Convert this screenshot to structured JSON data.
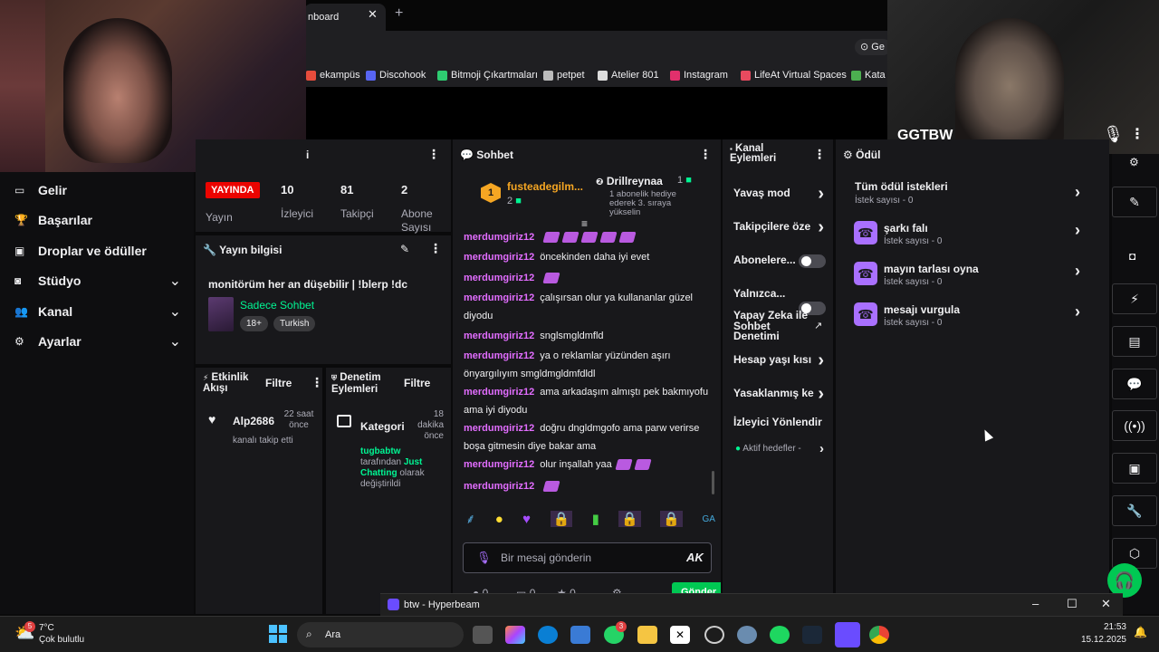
{
  "browser": {
    "tab_title": "nboard",
    "bookmarks": [
      "ekampüs",
      "Discohook",
      "Bitmoji Çıkartmaları",
      "petpet",
      "Atelier 801",
      "Instagram",
      "LifeAt Virtual Spaces",
      "Kata"
    ],
    "bookmark_colors": [
      "#e74c3c",
      "#5865f2",
      "#2ecc71",
      "#bbbbbb",
      "#dddddd",
      "#e1306c",
      "#e84a5f",
      "#4caf50"
    ],
    "search_label": "Ge"
  },
  "webcam_right": {
    "name": "GGTBW"
  },
  "sidebar": {
    "items": [
      {
        "label": "Gelir",
        "icon": "dollar-icon",
        "chevron": false
      },
      {
        "label": "Başarılar",
        "icon": "trophy-icon",
        "chevron": false
      },
      {
        "label": "Droplar ve ödüller",
        "icon": "gift-icon",
        "chevron": false
      },
      {
        "label": "Stüdyo",
        "icon": "camera-icon",
        "chevron": true
      },
      {
        "label": "Kanal",
        "icon": "users-icon",
        "chevron": true
      },
      {
        "label": "Ayarlar",
        "icon": "gear-icon",
        "chevron": true
      }
    ]
  },
  "stats": {
    "header_suffix": "i",
    "live_badge": "YAYINDA",
    "live_label": "Yayın",
    "viewers_value": "10",
    "viewers_label": "İzleyici",
    "followers_value": "81",
    "followers_label": "Takipçi",
    "subs_value": "2",
    "subs_label": "Abone Sayısı"
  },
  "stream_info": {
    "header": "Yayın bilgisi",
    "title": "monitörüm her an düşebilir | !blerp !dc",
    "category": "Sadece Sohbet",
    "tags": [
      "18+",
      "Turkish"
    ]
  },
  "activity": {
    "header": "Etkinlik Akışı",
    "filter": "Filtre",
    "user": "Alp2686",
    "time": "22 saat önce",
    "text": "kanalı takip etti"
  },
  "moderation": {
    "header": "Denetim Eylemleri",
    "filter": "Filtre",
    "title": "Kategori",
    "time": "18 dakika önce",
    "user": "tugbabtw",
    "text1": "tarafından",
    "category": "Just Chatting",
    "text2": "olarak değiştirildi"
  },
  "chat": {
    "header": "Sohbet",
    "leader1_name": "fusteadegilm...",
    "leader1_count": "2",
    "leader2_name": "Drillreynaa",
    "leader2_count": "1",
    "leader2_note": "1 abonelik hediye ederek 3. sıraya yükselin",
    "messages": [
      {
        "user": "merdumgiriz12",
        "text": "",
        "emotes": 5
      },
      {
        "user": "merdumgiriz12",
        "text": "öncekinden daha iyi evet",
        "emotes": 0
      },
      {
        "user": "merdumgiriz12",
        "text": "",
        "emotes": 1
      },
      {
        "user": "merdumgiriz12",
        "text": "çalışırsan olur ya kullananlar güzel diyodu",
        "emotes": 0
      },
      {
        "user": "merdumgiriz12",
        "text": "snglsmgldmfld",
        "emotes": 0
      },
      {
        "user": "merdumgiriz12",
        "text": "ya o reklamlar yüzünden aşırı önyargılıyım smgldmgldmfdldl",
        "emotes": 0
      },
      {
        "user": "merdumgiriz12",
        "text": "ama arkadaşım almıştı pek bakmıyofu ama iyi diyodu",
        "emotes": 0
      },
      {
        "user": "merdumgiriz12",
        "text": "doğru dngldmgofo ama parw verirse boşa gitmesin diye bakar ama",
        "emotes": 0
      },
      {
        "user": "merdumgiriz12",
        "text": "olur inşallah yaa",
        "emotes": 2
      },
      {
        "user": "merdumgiriz12",
        "text": "",
        "emotes": 1
      }
    ],
    "placeholder": "Bir mesaj gönderin",
    "send": "Gönder",
    "bottom_counts": [
      "0",
      "0",
      "0"
    ]
  },
  "channel_actions": {
    "header": "Kanal Eylemleri",
    "items": [
      {
        "label": "Yavaş mod",
        "type": "arrow"
      },
      {
        "label": "Takipçilere öze",
        "type": "arrow"
      },
      {
        "label": "Abonelere...",
        "type": "toggle"
      },
      {
        "label": "Yalnızca...",
        "type": "toggle"
      },
      {
        "label": "Yapay Zeka ile Sohbet Denetimi",
        "type": "external"
      },
      {
        "label": "Hesap yaşı kısı",
        "type": "arrow"
      },
      {
        "label": "Yasaklanmış ke",
        "type": "arrow"
      },
      {
        "label": "İzleyici Yönlendir",
        "type": "none"
      }
    ],
    "active_targets": "Aktif hedefler -"
  },
  "rewards": {
    "header": "Ödül",
    "all_requests": "Tüm ödül istekleri",
    "all_count": "İstek sayısı - 0",
    "items": [
      {
        "name": "şarkı falı",
        "count": "İstek sayısı - 0"
      },
      {
        "name": "mayın tarlası oyna",
        "count": "İstek sayısı - 0"
      },
      {
        "name": "mesajı vurgula",
        "count": "İstek sayısı - 0"
      }
    ]
  },
  "hyperbeam": {
    "title": "btw - Hyperbeam"
  },
  "taskbar": {
    "temp": "7°C",
    "weather": "Çok bulutlu",
    "weather_badge": "5",
    "search": "Ara",
    "time": "21:53",
    "date": "15.12.2025",
    "whatsapp_badge": "3"
  }
}
